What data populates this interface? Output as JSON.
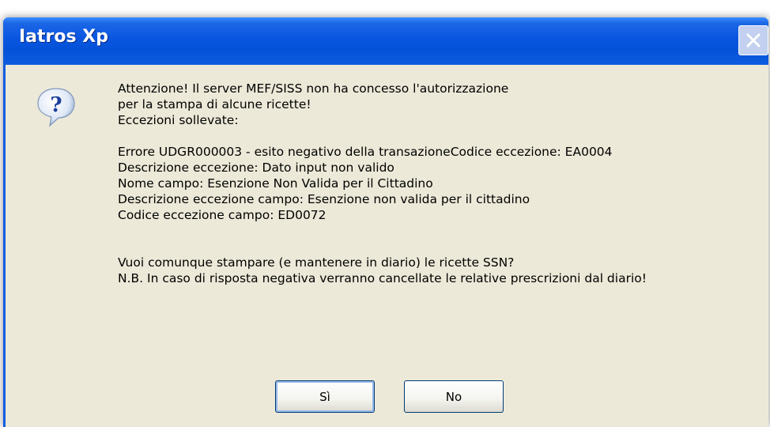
{
  "window": {
    "title": "Iatros Xp",
    "icon": "question-icon",
    "close_icon": "close-icon"
  },
  "message": {
    "lines_intro": [
      "Attenzione! Il server MEF/SISS non ha concesso l'autorizzazione",
      "per la stampa di alcune ricette!",
      "Eccezioni sollevate:"
    ],
    "lines_details": [
      "Errore UDGR000003 - esito negativo della transazioneCodice eccezione: EA0004",
      "Descrizione eccezione: Dato input non valido",
      "Nome campo: Esenzione Non Valida per il Cittadino",
      "Descrizione eccezione campo: Esenzione non valida per il cittadino",
      "Codice eccezione campo: ED0072"
    ],
    "lines_question": [
      "Vuoi comunque stampare (e mantenere in diario) le ricette SSN?",
      "N.B. In caso di risposta negativa verranno cancellate le relative prescrizioni dal diario!"
    ]
  },
  "buttons": {
    "yes_label": "Sì",
    "no_label": "No"
  },
  "colors": {
    "titlebar": "#0a55e0",
    "dialog_bg": "#ece9d8",
    "button_border": "#003c74"
  }
}
